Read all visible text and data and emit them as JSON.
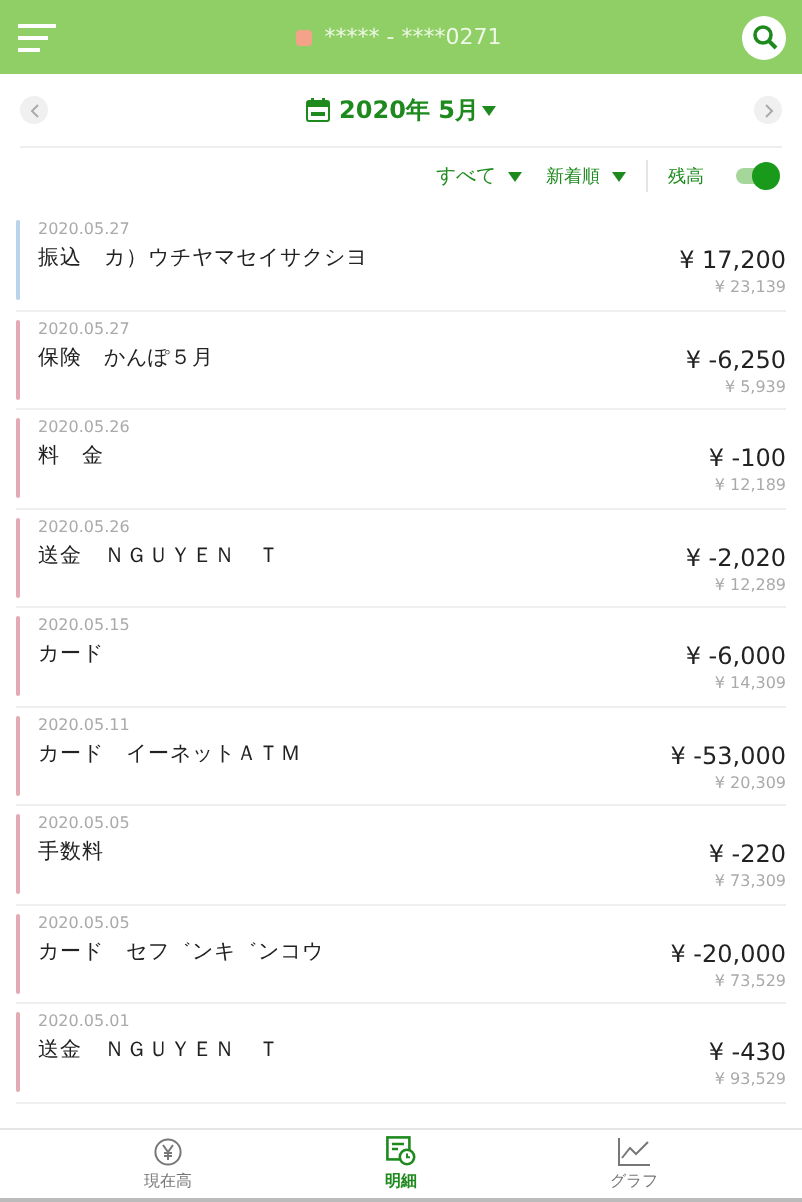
{
  "header": {
    "account": "***** - ****0271"
  },
  "month_nav": {
    "label": "2020年 5月"
  },
  "filters": {
    "type_filter": "すべて",
    "sort": "新着順",
    "balance_label": "残高",
    "balance_on": true
  },
  "transactions": [
    {
      "date": "2020.05.27",
      "description": "振込　カ）ウチヤマセイサクシヨ",
      "amount": "¥ 17,200",
      "balance": "¥ 23,139",
      "color": "#b9d3ea"
    },
    {
      "date": "2020.05.27",
      "description": "保険　かんぽ５月",
      "amount": "¥ -6,250",
      "balance": "¥ 5,939",
      "color": "#e3aab5"
    },
    {
      "date": "2020.05.26",
      "description": "料　金",
      "amount": "¥ -100",
      "balance": "¥ 12,189",
      "color": "#e3aab5"
    },
    {
      "date": "2020.05.26",
      "description": "送金　ＮＧＵＹＥＮ　Ｔ",
      "amount": "¥ -2,020",
      "balance": "¥ 12,289",
      "color": "#e3aab5"
    },
    {
      "date": "2020.05.15",
      "description": "カード",
      "amount": "¥ -6,000",
      "balance": "¥ 14,309",
      "color": "#e3aab5"
    },
    {
      "date": "2020.05.11",
      "description": "カード　イーネットＡＴＭ",
      "amount": "¥ -53,000",
      "balance": "¥ 20,309",
      "color": "#e3aab5"
    },
    {
      "date": "2020.05.05",
      "description": "手数料",
      "amount": "¥ -220",
      "balance": "¥ 73,309",
      "color": "#e3aab5"
    },
    {
      "date": "2020.05.05",
      "description": "カード　セフ゛ンキ゛ンコウ",
      "amount": "¥ -20,000",
      "balance": "¥ 73,529",
      "color": "#e3aab5"
    },
    {
      "date": "2020.05.01",
      "description": "送金　ＮＧＵＹＥＮ　Ｔ",
      "amount": "¥ -430",
      "balance": "¥ 93,529",
      "color": "#e3aab5"
    }
  ],
  "tabs": [
    {
      "label": "現在高",
      "kind": "balance",
      "selected": false
    },
    {
      "label": "明細",
      "kind": "statement",
      "selected": true
    },
    {
      "label": "グラフ",
      "kind": "graph",
      "selected": false
    }
  ]
}
